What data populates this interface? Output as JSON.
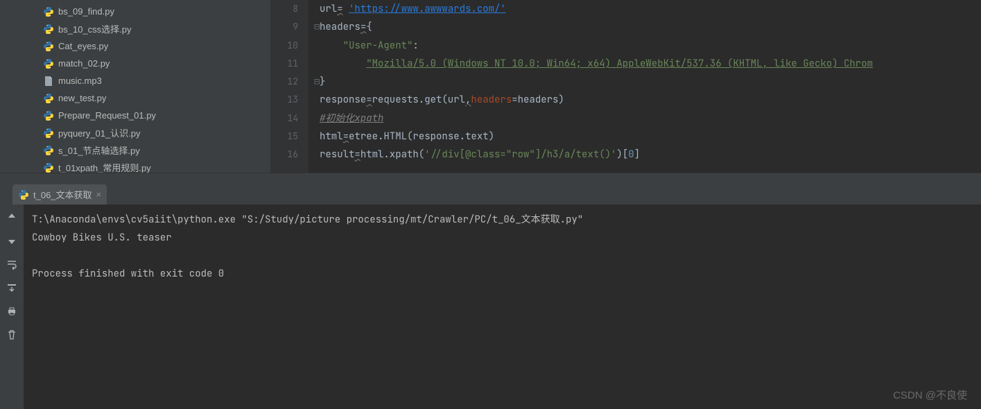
{
  "sidebar": {
    "files": [
      {
        "name": "bs_09_find.py",
        "type": "py"
      },
      {
        "name": "bs_10_css选择.py",
        "type": "py"
      },
      {
        "name": "Cat_eyes.py",
        "type": "py"
      },
      {
        "name": "match_02.py",
        "type": "py"
      },
      {
        "name": "music.mp3",
        "type": "file"
      },
      {
        "name": "new_test.py",
        "type": "py"
      },
      {
        "name": "Prepare_Request_01.py",
        "type": "py"
      },
      {
        "name": "pyquery_01_认识.py",
        "type": "py"
      },
      {
        "name": "s_01_节点轴选择.py",
        "type": "py"
      },
      {
        "name": "t_01xpath_常用规则.py",
        "type": "py"
      }
    ]
  },
  "editor": {
    "line_numbers": [
      "8",
      "9",
      "10",
      "11",
      "12",
      "13",
      "14",
      "15",
      "16"
    ],
    "code": {
      "l8_a": "url",
      "l8_eq": "=",
      "l8_b": " ",
      "l8_url": "'https://www.awwwards.com/'",
      "l9_a": "headers",
      "l9_eq": "=",
      "l9_b": "{",
      "l10_key": "\"User-Agent\"",
      "l10_colon": ":",
      "l11_val": "\"Mozilla/5.0 (Windows NT 10.0; Win64; x64) AppleWebKit/537.36 (KHTML, like Gecko) Chrom",
      "l12": "}",
      "l13_a": "response",
      "l13_eq": "=",
      "l13_b": "requests.get(url",
      "l13_c": ",",
      "l13_p": "headers",
      "l13_d": "=headers)",
      "l14": "#初始化xpath",
      "l15_a": "html",
      "l15_eq": "=",
      "l15_b": "etree.HTML(response.text)",
      "l16_a": "result",
      "l16_eq": "=",
      "l16_b": "html.xpath(",
      "l16_str": "'//div[@class=\"row\"]/h3/a/text()'",
      "l16_c": ")[",
      "l16_idx": "0",
      "l16_d": "]"
    }
  },
  "run": {
    "tab_label": "t_06_文本获取",
    "cmd": "T:\\Anaconda\\envs\\cv5aiit\\python.exe \"S:/Study/picture processing/mt/Crawler/PC/t_06_文本获取.py\"",
    "out1": "Cowboy Bikes U.S. teaser",
    "out2": "",
    "out3": "Process finished with exit code 0"
  },
  "watermark": "CSDN @不良使"
}
